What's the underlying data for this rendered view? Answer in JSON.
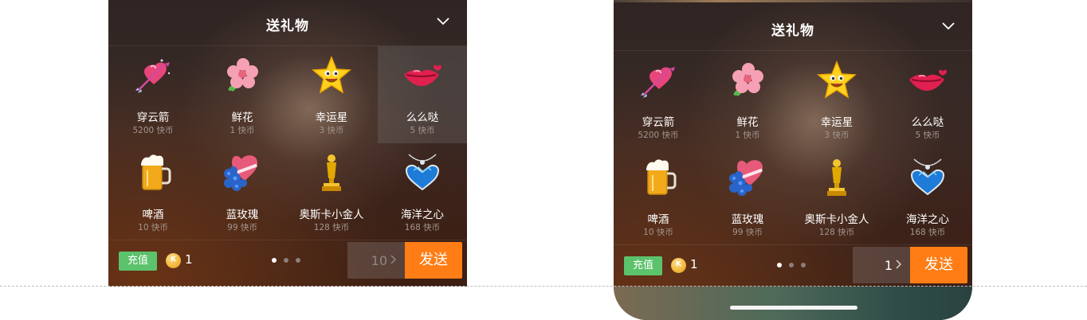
{
  "panels": [
    {
      "title": "送礼物",
      "gifts": [
        {
          "name": "穿云箭",
          "price": "5200 快币",
          "icon": "cupid-arrow-heart-icon"
        },
        {
          "name": "鲜花",
          "price": "1 快币",
          "icon": "flower-icon"
        },
        {
          "name": "幸运星",
          "price": "3 快币",
          "icon": "lucky-star-icon"
        },
        {
          "name": "么么哒",
          "price": "5 快币",
          "icon": "lips-kiss-icon"
        },
        {
          "name": "啤酒",
          "price": "10 快币",
          "icon": "beer-mug-icon"
        },
        {
          "name": "蓝玫瑰",
          "price": "99 快币",
          "icon": "blue-rose-gift-icon"
        },
        {
          "name": "奥斯卡小金人",
          "price": "128 快币",
          "icon": "oscar-statue-icon"
        },
        {
          "name": "海洋之心",
          "price": "168 快币",
          "icon": "heart-of-ocean-necklace-icon"
        }
      ],
      "selected_index": 3,
      "recharge_label": "充值",
      "coin_symbol": "K",
      "balance": "1",
      "quantity": "10",
      "send_label": "发送"
    },
    {
      "title": "送礼物",
      "gifts": [
        {
          "name": "穿云箭",
          "price": "5200 快币",
          "icon": "cupid-arrow-heart-icon"
        },
        {
          "name": "鲜花",
          "price": "1 快币",
          "icon": "flower-icon"
        },
        {
          "name": "幸运星",
          "price": "3 快币",
          "icon": "lucky-star-icon"
        },
        {
          "name": "么么哒",
          "price": "5 快币",
          "icon": "lips-kiss-icon"
        },
        {
          "name": "啤酒",
          "price": "10 快币",
          "icon": "beer-mug-icon"
        },
        {
          "name": "蓝玫瑰",
          "price": "99 快币",
          "icon": "blue-rose-gift-icon"
        },
        {
          "name": "奥斯卡小金人",
          "price": "128 快币",
          "icon": "oscar-statue-icon"
        },
        {
          "name": "海洋之心",
          "price": "168 快币",
          "icon": "heart-of-ocean-necklace-icon"
        }
      ],
      "selected_index": -1,
      "recharge_label": "充值",
      "coin_symbol": "K",
      "balance": "1",
      "quantity": "1",
      "send_label": "发送"
    }
  ],
  "colors": {
    "send": "#ff7d14",
    "recharge": "#5cc26c",
    "coin": "#f2b63a"
  },
  "pager": {
    "pages": 3,
    "active": 0
  }
}
